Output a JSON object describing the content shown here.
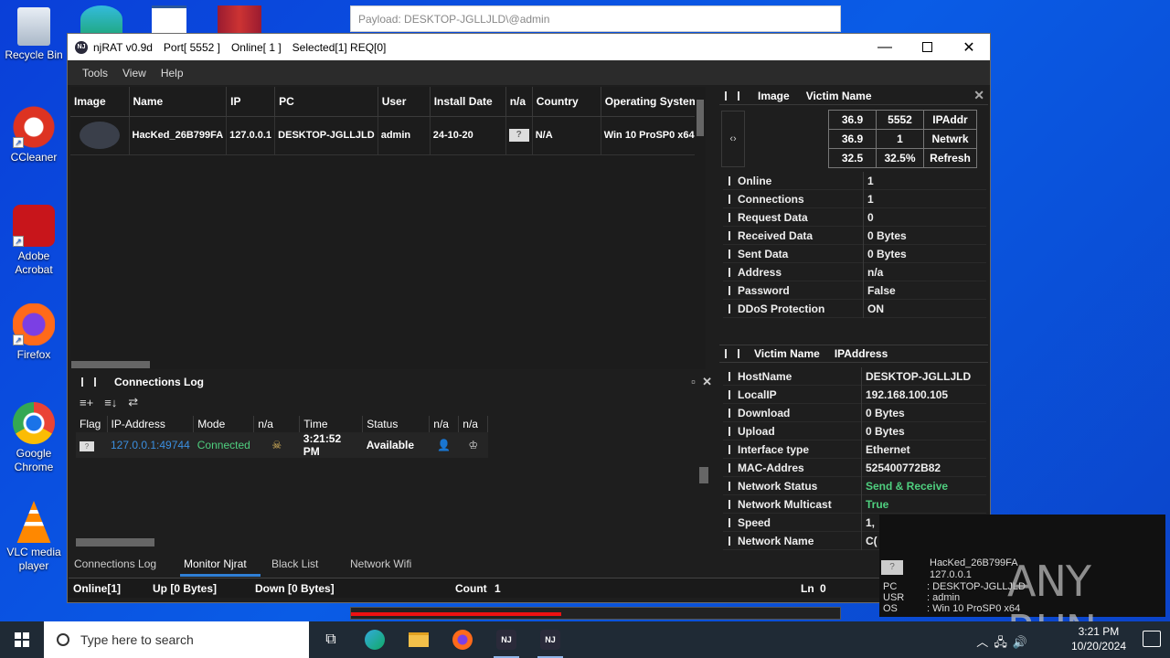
{
  "desktop": {
    "icons": [
      {
        "label": "Recycle Bin"
      },
      {
        "label": "CCleaner"
      },
      {
        "label": "Adobe Acrobat"
      },
      {
        "label": "Firefox"
      },
      {
        "label": "Google Chrome"
      },
      {
        "label": "VLC media player"
      }
    ]
  },
  "payload_bar": {
    "text": "Payload: DESKTOP-JGLLJLD\\@admin"
  },
  "window": {
    "title": "njRAT v0.9d",
    "port": "Port[ 5552 ]",
    "online": "Online[ 1 ]",
    "selected": "Selected[1] REQ[0]",
    "logo_text": "NJ"
  },
  "menu": {
    "items": [
      "Tools",
      "View",
      "Help"
    ]
  },
  "grid": {
    "columns": [
      "Image",
      "Name",
      "IP",
      "PC",
      "User",
      "Install Date",
      "n/a",
      "Country",
      "Operating System"
    ],
    "rows": [
      {
        "name": "HacKed_26B799FA",
        "ip": "127.0.0.1",
        "pc": "DESKTOP-JGLLJLD",
        "user": "admin",
        "install_date": "24-10-20",
        "flag": "?",
        "country": "N/A",
        "os": "Win 10 ProSP0 x64"
      }
    ]
  },
  "right_panel": {
    "header": {
      "image": "Image",
      "victim_name": "Victim Name"
    },
    "code_button": "‹›",
    "stats": [
      [
        "36.9",
        "5552",
        "IPAddr"
      ],
      [
        "36.9",
        "1",
        "Netwrk"
      ],
      [
        "32.5",
        "32.5%",
        "Refresh"
      ]
    ],
    "props1": [
      {
        "k": "Online",
        "v": "1"
      },
      {
        "k": "Connections",
        "v": "1"
      },
      {
        "k": "Request Data",
        "v": "0"
      },
      {
        "k": "Received Data",
        "v": "0 Bytes"
      },
      {
        "k": "Sent Data",
        "v": "0 Bytes"
      },
      {
        "k": "Address",
        "v": "n/a"
      },
      {
        "k": "Password",
        "v": "False"
      },
      {
        "k": "DDoS Protection",
        "v": "ON"
      }
    ],
    "header2": {
      "victim_name": "Victim Name",
      "ip": "IPAddress"
    },
    "props2": [
      {
        "k": "HostName",
        "v": "DESKTOP-JGLLJLD"
      },
      {
        "k": "LocalIP",
        "v": "192.168.100.105"
      },
      {
        "k": "Download",
        "v": "0 Bytes"
      },
      {
        "k": "Upload",
        "v": "0 Bytes"
      },
      {
        "k": "Interface type",
        "v": "Ethernet"
      },
      {
        "k": "MAC-Addres",
        "v": "525400772B82"
      },
      {
        "k": "Network Status",
        "v": "Send & Receive",
        "green": true
      },
      {
        "k": "Network Multicast",
        "v": "True",
        "green": true
      },
      {
        "k": "Speed",
        "v": "1,"
      },
      {
        "k": "Network Name",
        "v": "C("
      }
    ]
  },
  "connections_log": {
    "title": "Connections Log",
    "columns": [
      "Flag",
      "IP-Address",
      "Mode",
      "n/a",
      "Time",
      "Status",
      "n/a",
      "n/a"
    ],
    "rows": [
      {
        "flag": "?",
        "ip": "127.0.0.1:49744",
        "mode": "Connected",
        "time": "3:21:52 PM",
        "status": "Available"
      }
    ]
  },
  "tabs": [
    "Connections Log",
    "Monitor Njrat",
    "Black List",
    "Network Wifi"
  ],
  "active_tab": "Monitor Njrat",
  "statusbar": {
    "online": "Online[1]",
    "up": "Up [0 Bytes]",
    "down": "Down [0 Bytes]",
    "count_label": "Count",
    "count": "1",
    "ln_label": "Ln",
    "ln": "0"
  },
  "progress": {
    "fraction": 0.43
  },
  "popup": {
    "title": "HacKed_26B799FA",
    "ip": "127.0.0.1",
    "rows": [
      {
        "k": "PC",
        "v": ": DESKTOP-JGLLJLD"
      },
      {
        "k": "USR",
        "v": ": admin"
      },
      {
        "k": "OS",
        "v": ": Win 10 ProSP0 x64"
      }
    ],
    "brand": "ANY RUN"
  },
  "taskbar": {
    "search_placeholder": "Type here to search",
    "time": "3:21 PM",
    "date": "10/20/2024"
  },
  "colors": {
    "accent": "#2f7fd6",
    "green": "#4fcf7f",
    "ip_link": "#3b8fe0"
  }
}
